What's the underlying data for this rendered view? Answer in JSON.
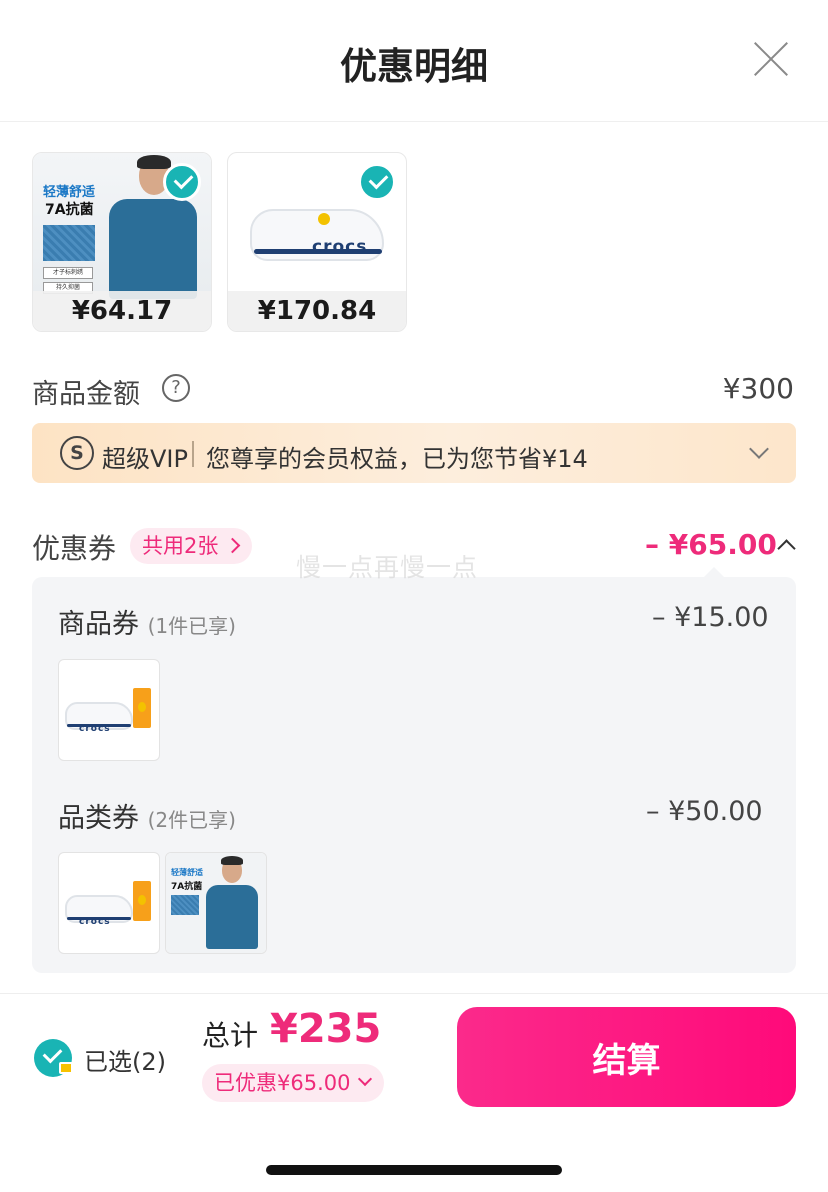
{
  "header": {
    "title": "优惠明细"
  },
  "products": [
    {
      "price": "¥64.17",
      "badge_line1": "轻薄舒适",
      "badge_line2": "7A抗菌",
      "tag1": "才子标刺绣",
      "tag2": "持久抑菌"
    },
    {
      "price": "¥170.84",
      "logo": "crocs"
    }
  ],
  "goods_amount": {
    "label": "商品金额",
    "help": "?",
    "value": "¥300"
  },
  "vip": {
    "icon": "S",
    "title": "超级VIP",
    "text": "您尊享的会员权益，已为您节省¥14"
  },
  "coupons": {
    "label": "优惠券",
    "shared_badge": "共用2张",
    "total": "– ¥65.00",
    "watermark": "慢一点再慢一点",
    "product_coupon": {
      "title": "商品券",
      "note": "(1件已享)",
      "amount": "– ¥15.00"
    },
    "category_coupon": {
      "title": "品类券",
      "note": "(2件已享)",
      "amount": "– ¥50.00"
    }
  },
  "footer": {
    "selected": "已选(2)",
    "total_label": "总计",
    "total_value": "¥235",
    "discount": "已优惠¥65.00",
    "checkout": "结算"
  },
  "colors": {
    "accent": "#ee2b7a",
    "teal": "#19b4b4",
    "vip_bg": "#fde3c4"
  }
}
